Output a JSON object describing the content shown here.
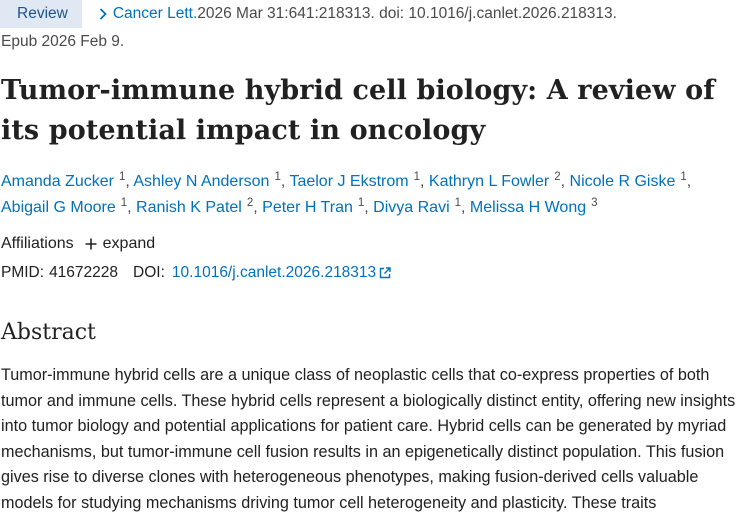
{
  "citation": {
    "badge": "Review",
    "journal": "Cancer Lett.",
    "details": " 2026 Mar 31:641:218313. doi: 10.1016/j.canlet.2026.218313.",
    "epub": "Epub 2026 Feb 9."
  },
  "article": {
    "title": "Tumor-immune hybrid cell biology: A review of its potential impact in oncology"
  },
  "authors": [
    {
      "name": "Amanda Zucker",
      "aff": "1"
    },
    {
      "name": "Ashley N Anderson",
      "aff": "1"
    },
    {
      "name": "Taelor J Ekstrom",
      "aff": "1"
    },
    {
      "name": "Kathryn L Fowler",
      "aff": "2"
    },
    {
      "name": "Nicole R Giske",
      "aff": "1"
    },
    {
      "name": "Abigail G Moore",
      "aff": "1"
    },
    {
      "name": "Ranish K Patel",
      "aff": "2"
    },
    {
      "name": "Peter H Tran",
      "aff": "1"
    },
    {
      "name": "Divya Ravi",
      "aff": "1"
    },
    {
      "name": "Melissa H Wong",
      "aff": "3"
    }
  ],
  "affiliations": {
    "label": "Affiliations",
    "expand_label": "expand"
  },
  "identifiers": {
    "pmid_label": "PMID:",
    "pmid": "41672228",
    "doi_label": "DOI:",
    "doi": "10.1016/j.canlet.2026.218313"
  },
  "abstract": {
    "heading": "Abstract",
    "text": "Tumor-immune hybrid cells are a unique class of neoplastic cells that co-express properties of both tumor and immune cells. These hybrid cells represent a biologically distinct entity, offering new insights into tumor biology and potential applications for patient care. Hybrid cells can be generated by myriad mechanisms, but tumor-immune cell fusion results in an epigenetically distinct population. This fusion gives rise to diverse clones with heterogeneous phenotypes, making fusion-derived cells valuable models for studying mechanisms driving tumor cell heterogeneity and plasticity. These traits"
  },
  "colors": {
    "link": "#0071bc",
    "badge_bg": "#dfe8f3",
    "badge_text": "#20558a",
    "text": "#212121",
    "muted": "#4a4a4a"
  },
  "icons": {
    "journal": "chevron-right-icon",
    "expand": "plus-icon",
    "doi": "external-link-icon"
  }
}
